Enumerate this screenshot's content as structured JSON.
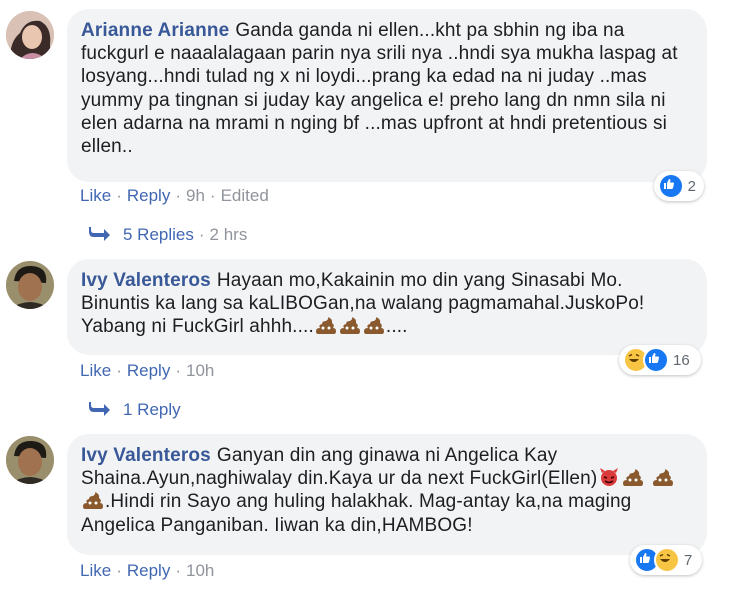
{
  "comments": [
    {
      "author": "Arianne Arianne",
      "text": "Ganda ganda ni ellen...kht pa sbhin ng iba na fuckgurl e naaalalagaan parin nya srili nya ..hndi sya mukha laspag at losyang...hndi tulad ng x ni loydi...prang ka edad na ni juday ..mas yummy pa tingnan si juday kay angelica e! preho lang dn nmn sila ni elen adarna na mrami n nging bf ...mas upfront at hndi pretentious si ellen..",
      "like_label": "Like",
      "reply_label": "Reply",
      "time": "9h",
      "edited": "Edited",
      "reaction_count": "2",
      "replies_label": "5 Replies",
      "replies_time": "2 hrs"
    },
    {
      "author": "Ivy Valenteros",
      "text_parts": [
        "Hayaan mo,Kakainin mo din yang Sinasabi Mo. Binuntis ka lang sa kaLIBOGan,na walang pagmamahal.JuskoPo! Yabang ni FuckGirl ahhh....",
        "...."
      ],
      "like_label": "Like",
      "reply_label": "Reply",
      "time": "10h",
      "reaction_count": "16",
      "replies_label": "1 Reply"
    },
    {
      "author": "Ivy Valenteros",
      "text_parts": [
        "Ganyan din ang ginawa ni Angelica Kay Shaina.Ayun,naghiwalay din.Kaya ur da next FuckGirl(Ellen)",
        ".Hindi rin Sayo ang huling halakhak. Mag-antay ka,na maging Angelica Panganiban. Iiwan ka din,HAMBOG!"
      ],
      "like_label": "Like",
      "reply_label": "Reply",
      "time": "10h",
      "reaction_count": "7"
    }
  ]
}
